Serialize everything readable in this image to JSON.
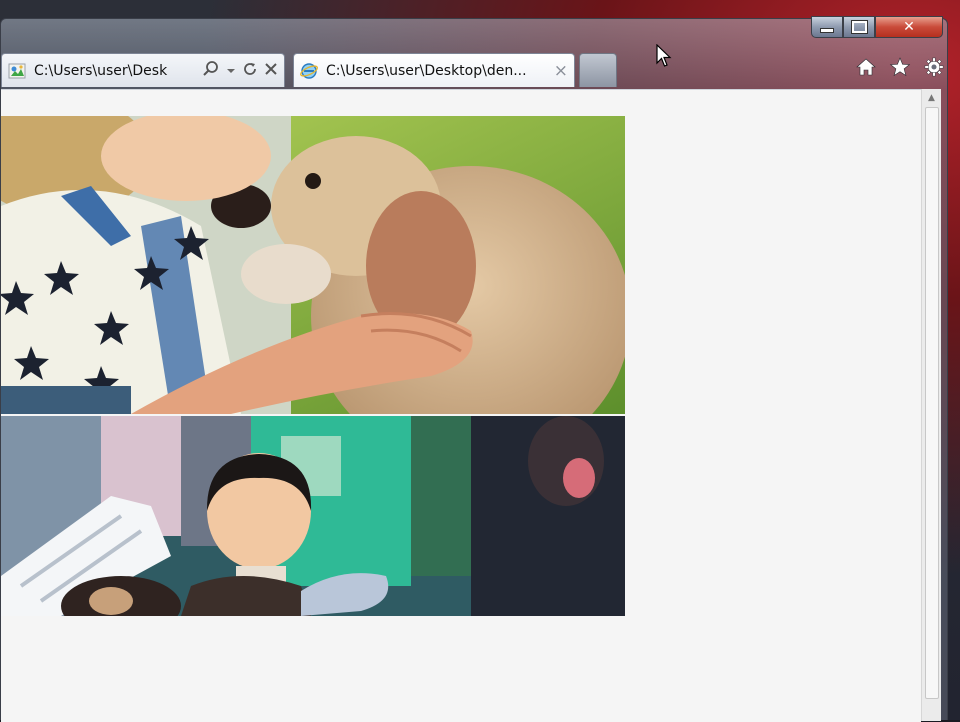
{
  "browser": {
    "address_tab": {
      "text": "C:\\Users\\user\\Desk",
      "icons": [
        "ie-favicon",
        "search-icon",
        "dropdown-icon",
        "refresh-icon",
        "stop-icon"
      ]
    },
    "page_tab": {
      "text": "C:\\Users\\user\\Desktop\\den...",
      "close": "×"
    },
    "caption": {
      "close_glyph": "✕"
    },
    "toolbar_icons": [
      "home-icon",
      "favorites-star-icon",
      "tools-gear-icon"
    ]
  },
  "content": {
    "images": [
      {
        "subject": "child-kissing-puppy-photo"
      },
      {
        "subject": "toddler-with-chimpanzees-photo"
      }
    ]
  },
  "colors": {
    "close_button": "#c94b3a",
    "content_bg": "#f5f5f5"
  }
}
